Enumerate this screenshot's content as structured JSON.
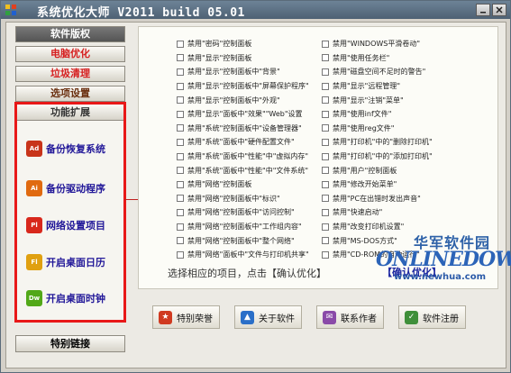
{
  "window": {
    "title": "系统优化大师 V2011 build 05.01"
  },
  "menu": {
    "items": [
      {
        "label": "软件版权"
      },
      {
        "label": "电脑优化"
      },
      {
        "label": "垃圾清理"
      },
      {
        "label": "选项设置"
      }
    ],
    "expand_header": "功能扩展",
    "features": [
      {
        "label": "备份恢复系统",
        "icon": "backup-icon",
        "color": "#c8341a"
      },
      {
        "label": "备份驱动程序",
        "icon": "driver-icon",
        "color": "#e06a10"
      },
      {
        "label": "网络设置项目",
        "icon": "network-icon",
        "color": "#d8281c"
      },
      {
        "label": "开启桌面日历",
        "icon": "calendar-icon",
        "color": "#e0a010"
      },
      {
        "label": "开启桌面时钟",
        "icon": "clock-icon",
        "color": "#52a818"
      }
    ],
    "special_link": "特别链接"
  },
  "options": {
    "col1": [
      "禁用\"密码\"控制面板",
      "禁用\"显示\"控制面板",
      "禁用\"显示\"控制面板中\"背景\"",
      "禁用\"显示\"控制面板中\"屏幕保护程序\"",
      "禁用\"显示\"控制面板中\"外观\"",
      "禁用\"显示\"面板中\"效果\"\"Web\"设置",
      "禁用\"系统\"控制面板中\"设备管理器\"",
      "禁用\"系统\"面板中\"硬件配置文件\"",
      "禁用\"系统\"面板中\"性能\"中\"虚拟内存\"",
      "禁用\"系统\"面板中\"性能\"中\"文件系统\"",
      "禁用\"网络\"控制面板",
      "禁用\"网络\"控制面板中\"标识\"",
      "禁用\"网络\"控制面板中\"访问控制\"",
      "禁用\"网络\"控制面板中\"工作组内容\"",
      "禁用\"网络\"控制面板中\"整个网络\"",
      "禁用\"网络\"面板中\"文件与打印机共享\""
    ],
    "col2": [
      "禁用\"WINDOWS平滑卷动\"",
      "禁用\"使用任务栏\"",
      "禁用\"磁盘空间不足时的警告\"",
      "禁用\"显示\"远程管理\"",
      "禁用\"显示\"注销\"菜单\"",
      "禁用\"使用inf文件\"",
      "禁用\"使用reg文件\"",
      "禁用\"打印机\"中的\"删除打印机\"",
      "禁用\"打印机\"中的\"添加打印机\"",
      "禁用\"用户\"控制面板",
      "禁用\"修改开始菜单\"",
      "禁用\"PC在出错时发出声音\"",
      "禁用\"快速启动\"",
      "禁用\"改变打印机设置\"",
      "禁用\"MS-DOS方式\"",
      "禁用\"CD-ROM的自动运行\""
    ],
    "hint": "选择相应的项目，点击【确认优化】",
    "confirm_label": "【确认优化】"
  },
  "watermark": {
    "cn": "华军软件园",
    "en": "ONLINEDOWN",
    "url": "www.newhua.com"
  },
  "bottom_buttons": [
    {
      "label": "特别荣誉",
      "icon": "star-icon",
      "color": "#d03a20"
    },
    {
      "label": "关于软件",
      "icon": "about-icon",
      "color": "#2a6fc8"
    },
    {
      "label": "联系作者",
      "icon": "mail-icon",
      "color": "#8a4aa8"
    },
    {
      "label": "软件注册",
      "icon": "register-icon",
      "color": "#3f8f3a"
    }
  ]
}
